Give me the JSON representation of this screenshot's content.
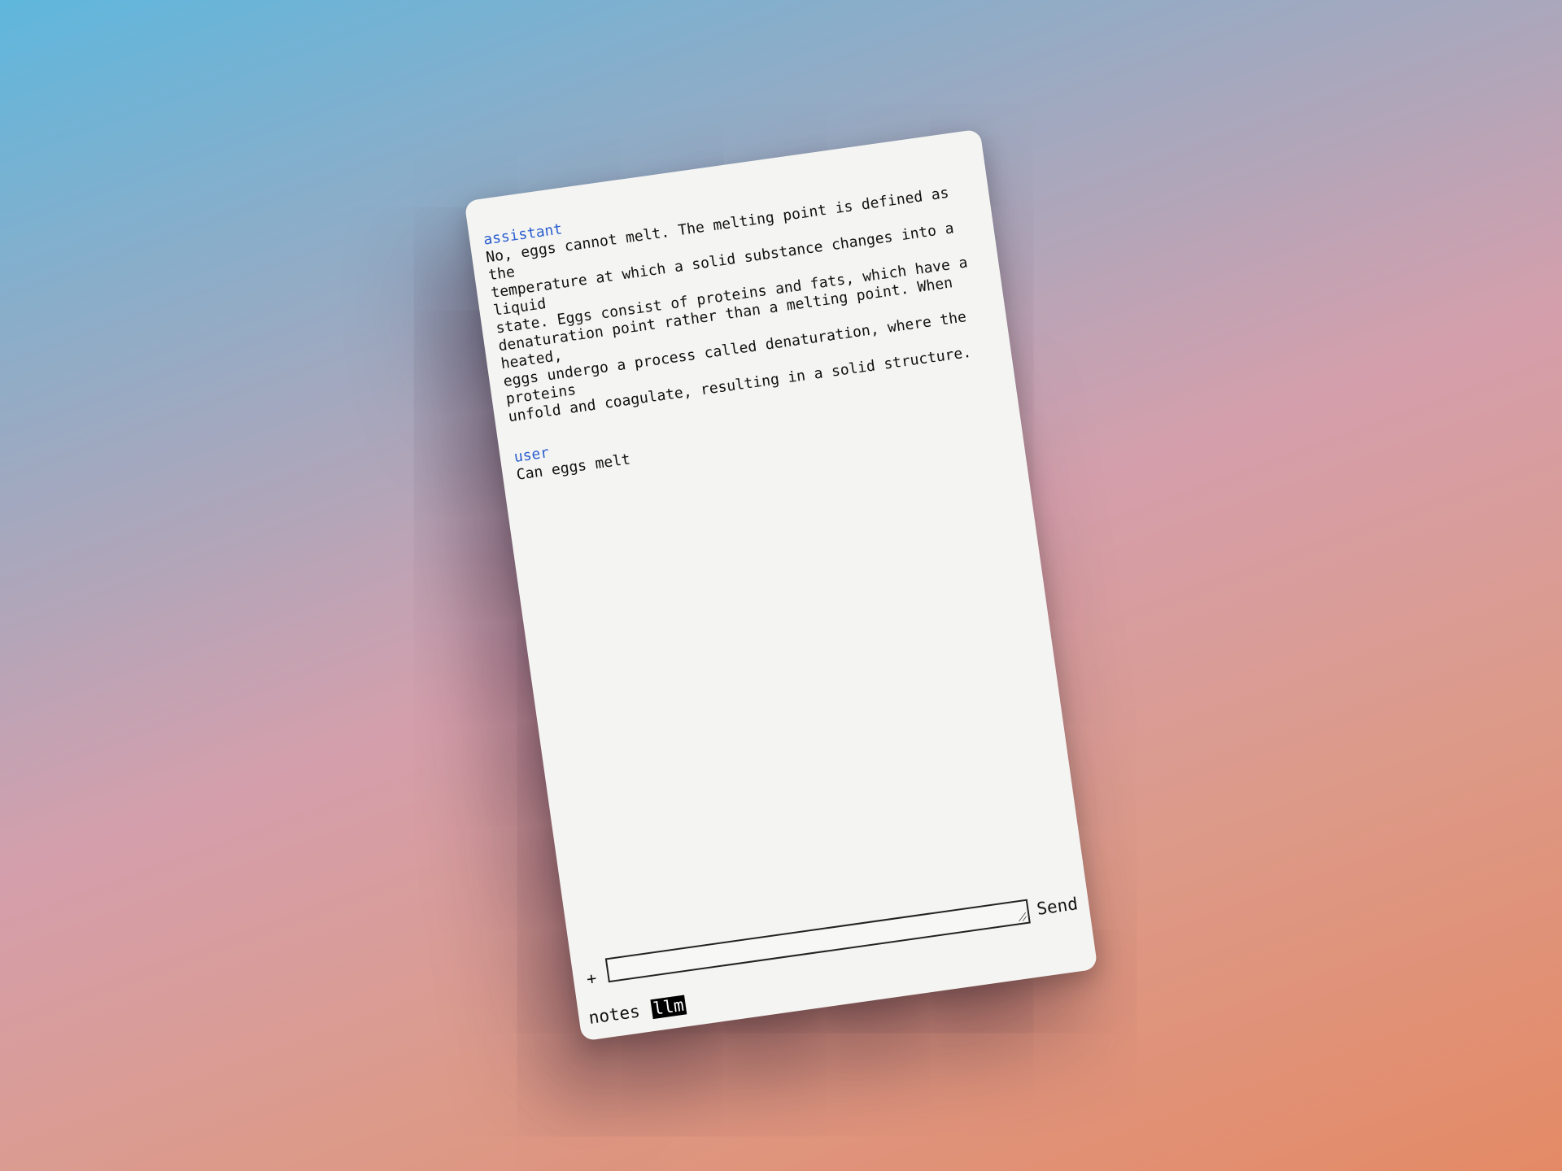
{
  "messages": [
    {
      "role": "assistant",
      "content": "No, eggs cannot melt. The melting point is defined as the\ntemperature at which a solid substance changes into a liquid\nstate. Eggs consist of proteins and fats, which have a\ndenaturation point rather than a melting point. When heated,\neggs undergo a process called denaturation, where the proteins\nunfold and coagulate, resulting in a solid structure."
    },
    {
      "role": "user",
      "content": "Can eggs melt"
    }
  ],
  "composer": {
    "plus_label": "+",
    "input_value": "",
    "send_label": "Send"
  },
  "footer": {
    "tabs": [
      {
        "label": "notes",
        "active": false
      },
      {
        "label": "llm",
        "active": true
      }
    ]
  },
  "colors": {
    "role_label": "#2b5fd0",
    "window_bg": "#f4f4f2",
    "active_tab_bg": "#000000"
  }
}
